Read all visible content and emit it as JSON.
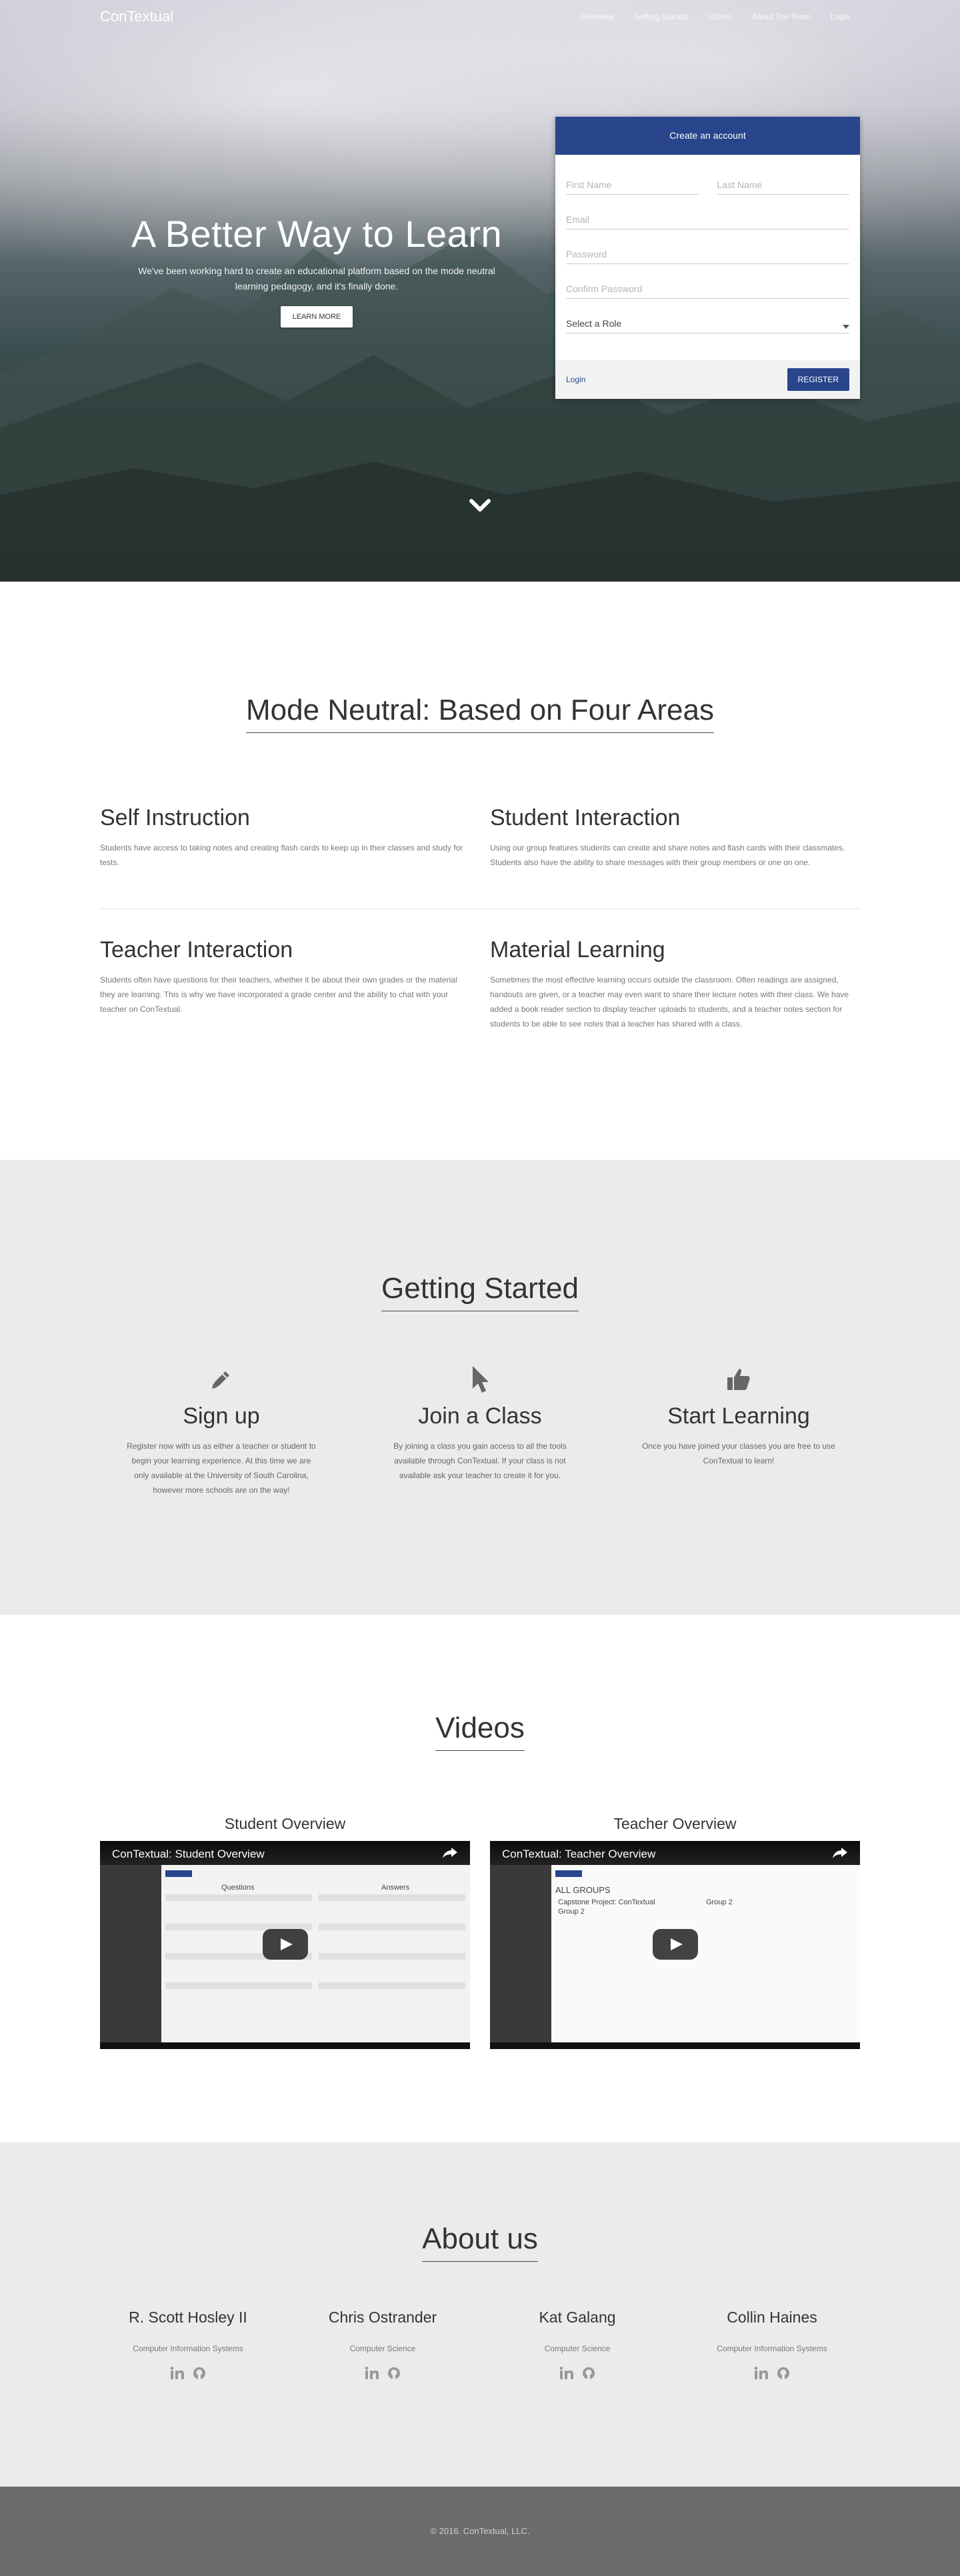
{
  "nav": {
    "brand": "ConTextual",
    "links": [
      "Overview",
      "Getting Started",
      "Videos",
      "About The Team",
      "Login"
    ]
  },
  "hero": {
    "title": "A Better Way to Learn",
    "subtitle": "We've been working hard to create an educational platform based on the mode neutral learning pedagogy, and it's finally done.",
    "button": "LEARN MORE"
  },
  "signup": {
    "title": "Create an account",
    "first_name": "First Name",
    "last_name": "Last Name",
    "email": "Email",
    "password": "Password",
    "confirm_password": "Confirm Password",
    "role": "Select a Role",
    "login": "Login",
    "register": "REGISTER"
  },
  "areas": {
    "title": "Mode Neutral: Based on Four Areas",
    "items": [
      {
        "title": "Self Instruction",
        "text": "Students have access to taking notes and creating flash cards to keep up in their classes and study for tests."
      },
      {
        "title": "Student Interaction",
        "text": "Using our group features students can create and share notes and flash cards with their classmates. Students also have the ability to share messages with their group members or one on one."
      },
      {
        "title": "Teacher Interaction",
        "text": "Students often have questions for their teachers, whether it be about their own grades or the material they are learning. This is why we have incorporated a grade center and the ability to chat with your teacher on ConTextual."
      },
      {
        "title": "Material Learning",
        "text": "Sometimes the most effective learning occurs outside the classroom. Often readings are assigned, handouts are given, or a teacher may even want to share their lecture notes with their class. We have added a book reader section to display teacher uploads to students, and a teacher notes section for students to be able to see notes that a teacher has shared with a class."
      }
    ]
  },
  "getting_started": {
    "title": "Getting Started",
    "steps": [
      {
        "icon": "pencil-icon",
        "title": "Sign up",
        "text": "Register now with us as either a teacher or student to begin your learning experience. At this time we are only available at the University of South Carolina, however more schools are on the way!"
      },
      {
        "icon": "cursor-icon",
        "title": "Join a Class",
        "text": "By joining a class you gain access to all the tools available through ConTextual. If your class is not available ask your teacher to create it for you."
      },
      {
        "icon": "thumbs-up-icon",
        "title": "Start Learning",
        "text": "Once you have joined your classes you are free to use ConTextual to learn!"
      }
    ]
  },
  "videos": {
    "title": "Videos",
    "items": [
      {
        "heading": "Student Overview",
        "video_title": "ConTextual: Student Overview"
      },
      {
        "heading": "Teacher Overview",
        "video_title": "ConTextual: Teacher Overview"
      }
    ],
    "teacher_screen": {
      "all_groups": "ALL GROUPS",
      "g1": "Capstone Project: ConTextual",
      "g2": "Group 2",
      "g3": "Group 2"
    },
    "student_screen": {
      "col1": "Questions",
      "col2": "Answers"
    }
  },
  "about": {
    "title": "About us",
    "members": [
      {
        "name": "R. Scott Hosley II",
        "major": "Computer Information Systems"
      },
      {
        "name": "Chris Ostrander",
        "major": "Computer Science"
      },
      {
        "name": "Kat Galang",
        "major": "Computer Science"
      },
      {
        "name": "Collin Haines",
        "major": "Computer Information Systems"
      }
    ],
    "social_icons": [
      "linkedin-icon",
      "github-icon"
    ]
  },
  "footer": {
    "text": "© 2016. ConTextual, LLC."
  },
  "colors": {
    "accent": "#29458c",
    "gray_section": "#ebebeb",
    "footer": "#6b6b6b"
  }
}
